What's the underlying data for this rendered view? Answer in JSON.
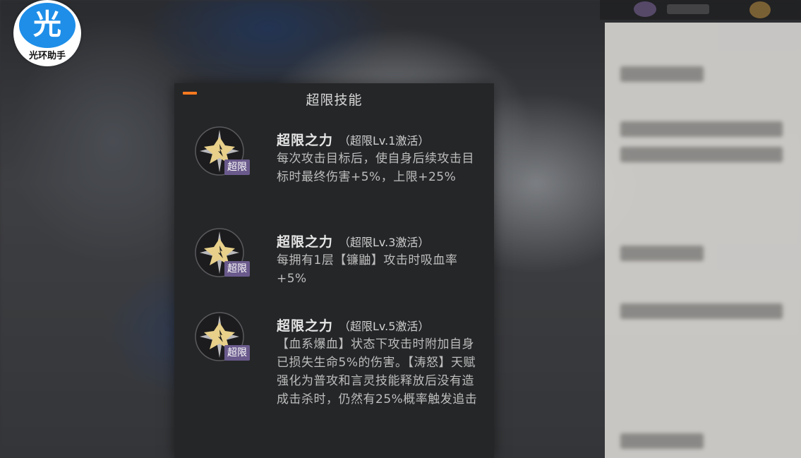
{
  "logo": {
    "char": "光",
    "text": "光环助手"
  },
  "popup": {
    "title": "超限技能",
    "accent_color": "#ff7a1f",
    "skills": [
      {
        "icon": "overlimit-star-icon",
        "badge": "超限",
        "name": "超限之力",
        "level": "（超限Lv.1激活）",
        "desc": "每次攻击目标后，使自身后续攻击目标时最终伤害+5%，上限+25%"
      },
      {
        "icon": "overlimit-star-icon",
        "badge": "超限",
        "name": "超限之力",
        "level": "（超限Lv.3激活）",
        "desc": "每拥有1层【镰鼬】攻击时吸血率+5%"
      },
      {
        "icon": "overlimit-star-icon",
        "badge": "超限",
        "name": "超限之力",
        "level": "（超限Lv.5激活）",
        "desc": "【血系爆血】状态下攻击时附加自身已损失生命5%的伤害。【涛怒】天赋强化为普攻和言灵技能释放后没有造成击杀时，仍然有25%概率触发追击"
      }
    ]
  },
  "colors": {
    "badge": "#6a5a8c",
    "panel": "#252628"
  }
}
